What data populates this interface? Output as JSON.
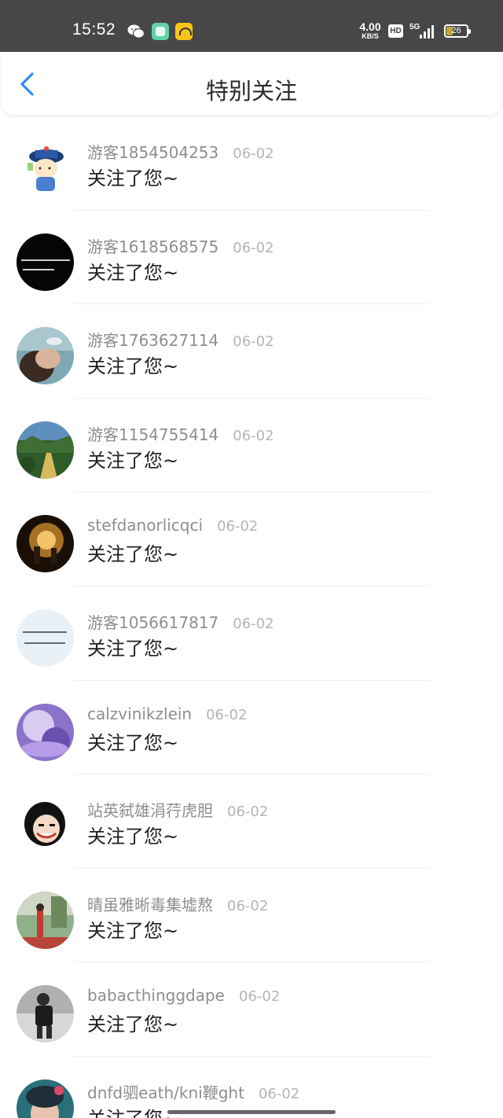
{
  "status_bar": {
    "time": "15:52",
    "speed_value": "4.00",
    "speed_unit": "KB/S",
    "hd": "HD",
    "network": "5G",
    "battery_level": "26",
    "icons": [
      "wechat-icon",
      "app-green-icon",
      "app-yellow-icon",
      "signal-icon",
      "battery-icon"
    ]
  },
  "nav": {
    "back_icon": "chevron-left-icon",
    "title": "特别关注",
    "accent_color": "#2e8ef0"
  },
  "followers": [
    {
      "name": "游客1854504253",
      "date": "06-02",
      "message": "关注了您~"
    },
    {
      "name": "游客1618568575",
      "date": "06-02",
      "message": "关注了您~"
    },
    {
      "name": "游客1763627114",
      "date": "06-02",
      "message": "关注了您~"
    },
    {
      "name": "游客1154755414",
      "date": "06-02",
      "message": "关注了您~"
    },
    {
      "name": "stefdanorlicqci",
      "date": "06-02",
      "message": "关注了您~"
    },
    {
      "name": "游客1056617817",
      "date": "06-02",
      "message": "关注了您~"
    },
    {
      "name": "calzvinikzlein",
      "date": "06-02",
      "message": "关注了您~"
    },
    {
      "name": "站英弑雄涓荇虎胆",
      "date": "06-02",
      "message": "关注了您~"
    },
    {
      "name": "晴虽雅晰毒集墟熬",
      "date": "06-02",
      "message": "关注了您~"
    },
    {
      "name": "babacthinggdape",
      "date": "06-02",
      "message": "关注了您~"
    },
    {
      "name": "dnfd驷eath/kni鞭ght",
      "date": "06-02",
      "message": "关注了您~"
    }
  ]
}
